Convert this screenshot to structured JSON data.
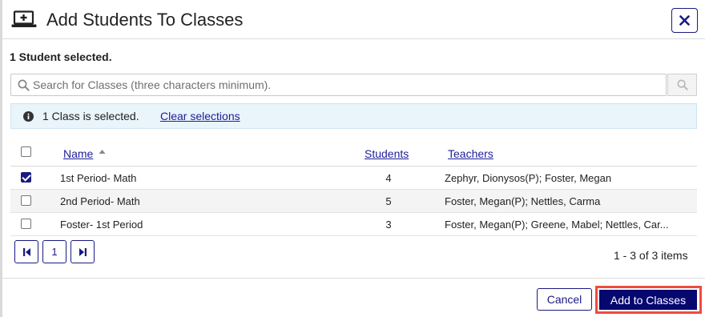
{
  "dialog": {
    "title": "Add Students To Classes",
    "close_label": "close"
  },
  "selection": {
    "students_text": "1 Student selected."
  },
  "search": {
    "placeholder": "Search for Classes (three characters minimum).",
    "value": ""
  },
  "info": {
    "message": "1 Class is selected.",
    "clear_label": "Clear selections"
  },
  "table": {
    "columns": {
      "name": "Name",
      "students": "Students",
      "teachers": "Teachers"
    },
    "sort": {
      "column": "name",
      "direction": "ascending"
    },
    "rows": [
      {
        "checked": true,
        "name": "1st Period- Math",
        "students": "4",
        "teachers": "Zephyr, Dionysos(P); Foster, Megan"
      },
      {
        "checked": false,
        "name": "2nd Period- Math",
        "students": "5",
        "teachers": "Foster, Megan(P); Nettles, Carma"
      },
      {
        "checked": false,
        "name": "Foster- 1st Period",
        "students": "3",
        "teachers": "Foster, Megan(P); Greene, Mabel; Nettles, Car..."
      }
    ]
  },
  "pager": {
    "current_page": "1",
    "info": "1 - 3 of 3 items"
  },
  "footer": {
    "cancel_label": "Cancel",
    "add_label": "Add to Classes"
  },
  "colors": {
    "accent": "#1a1a80",
    "primary_button": "#070770",
    "highlight_outline": "#ef4b3f",
    "info_background": "#e9f4fb"
  }
}
